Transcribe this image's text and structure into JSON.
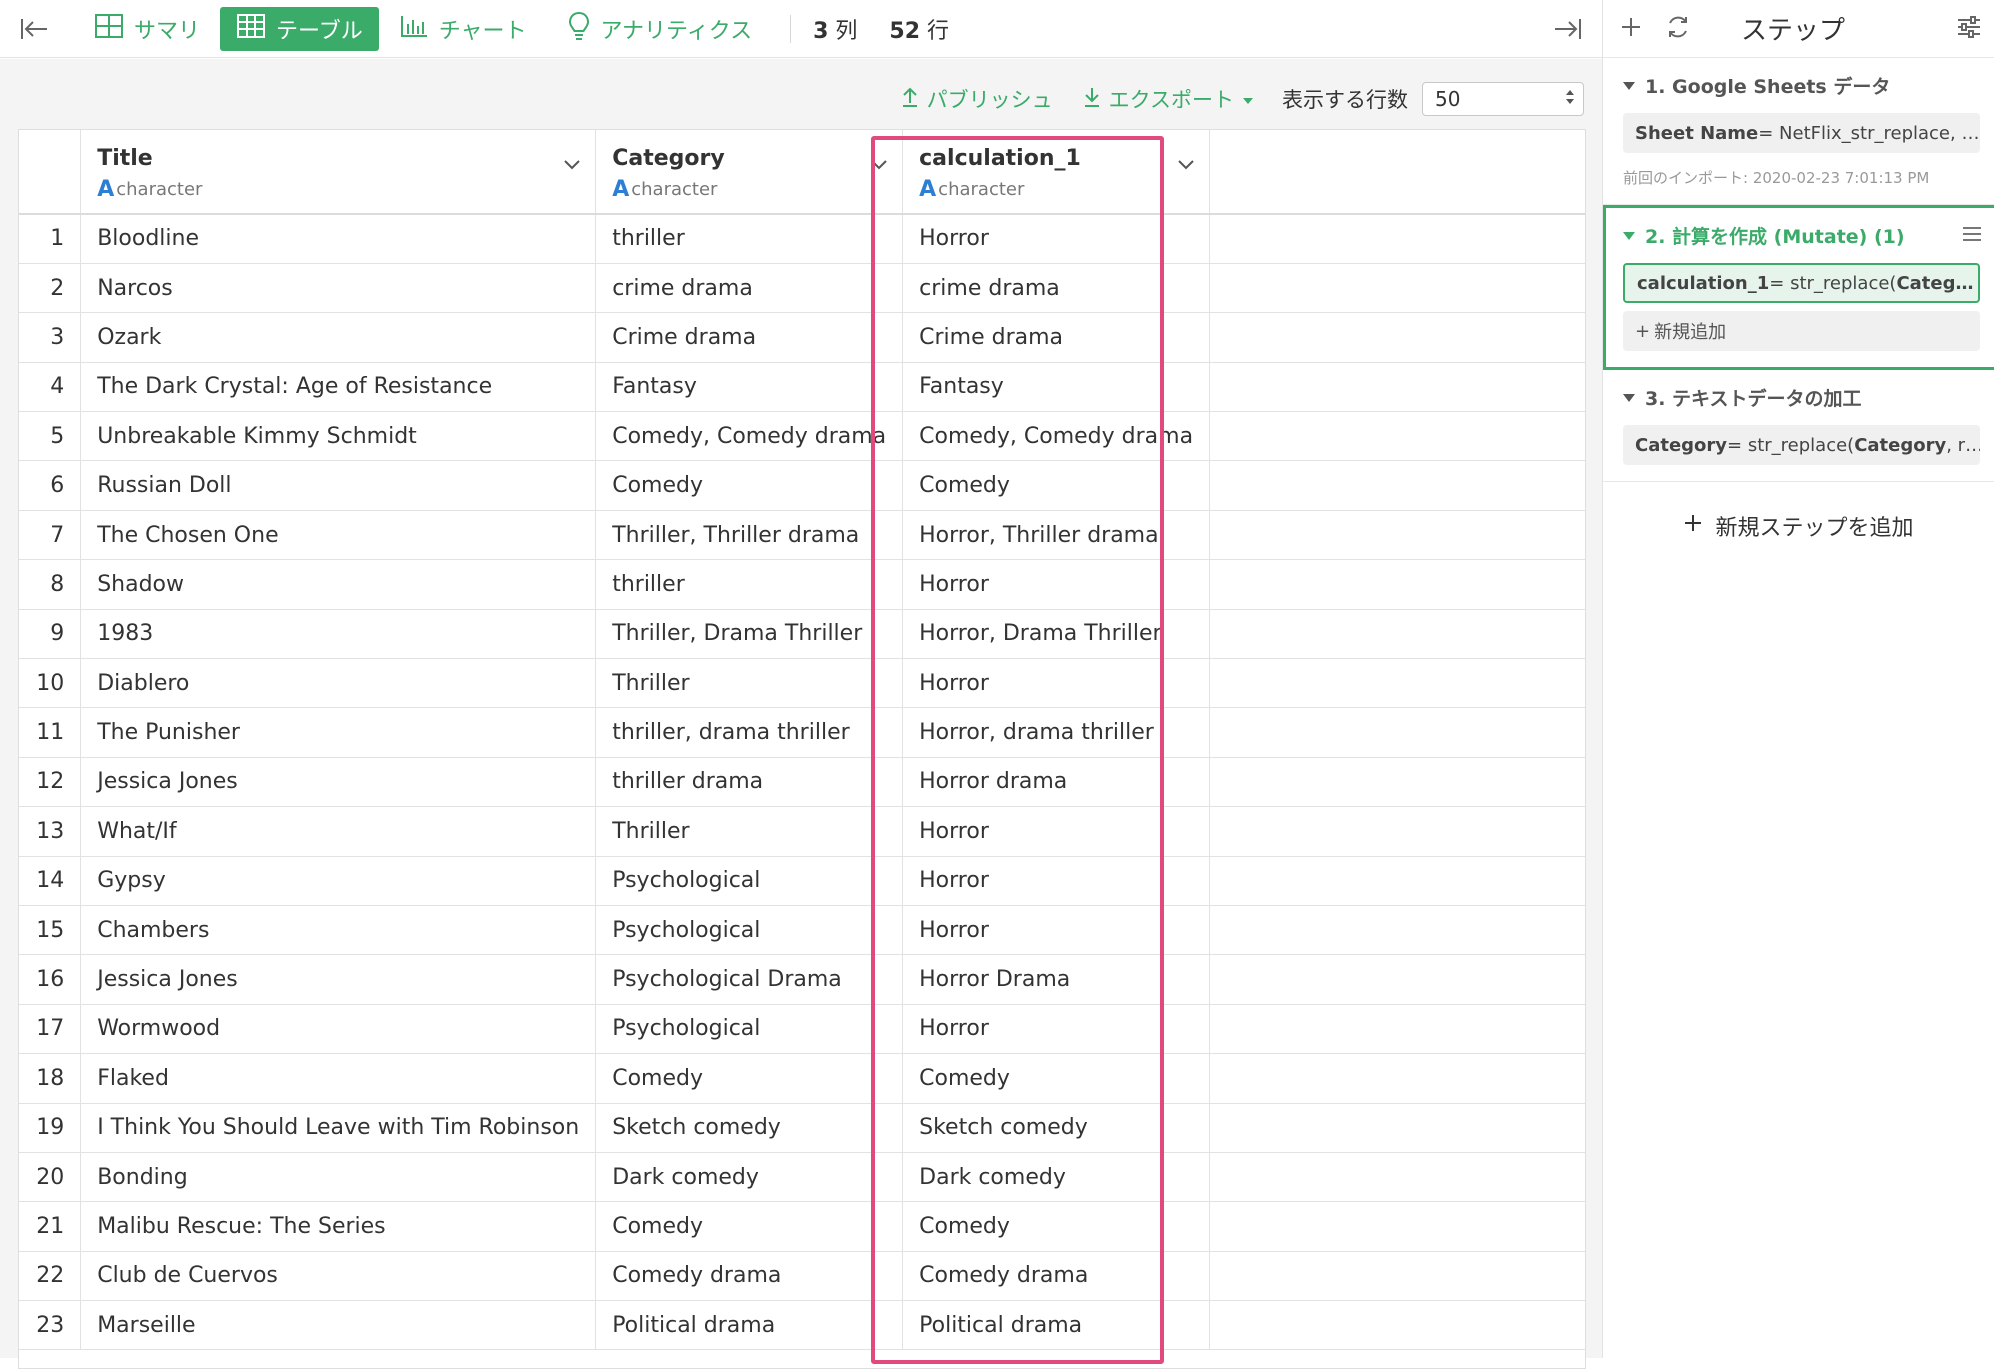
{
  "toolbar": {
    "tabs": [
      {
        "label": "サマリ",
        "icon": "summary-grid-icon"
      },
      {
        "label": "テーブル",
        "icon": "table-icon"
      },
      {
        "label": "チャート",
        "icon": "bar-chart-icon"
      },
      {
        "label": "アナリティクス",
        "icon": "lightbulb-icon"
      }
    ],
    "columns_count": "3",
    "columns_unit": "列",
    "rows_count": "52",
    "rows_unit": "行"
  },
  "subbar": {
    "publish_label": "パブリッシュ",
    "export_label": "エクスポート",
    "rows_label": "表示する行数",
    "rows_value": "50"
  },
  "table": {
    "columns": [
      {
        "name": "Title",
        "type": "character"
      },
      {
        "name": "Category",
        "type": "character"
      },
      {
        "name": "calculation_1",
        "type": "character"
      }
    ],
    "rows": [
      [
        "1",
        "Bloodline",
        "thriller",
        "Horror"
      ],
      [
        "2",
        "Narcos",
        "crime drama",
        "crime drama"
      ],
      [
        "3",
        "Ozark",
        "Crime drama",
        "Crime drama"
      ],
      [
        "4",
        "The Dark Crystal: Age of Resistance",
        "Fantasy",
        "Fantasy"
      ],
      [
        "5",
        "Unbreakable Kimmy Schmidt",
        "Comedy, Comedy drama",
        "Comedy, Comedy drama"
      ],
      [
        "6",
        "Russian Doll",
        "Comedy",
        "Comedy"
      ],
      [
        "7",
        "The Chosen One",
        "Thriller, Thriller drama",
        "Horror, Thriller drama"
      ],
      [
        "8",
        "Shadow",
        "thriller",
        "Horror"
      ],
      [
        "9",
        "1983",
        "Thriller, Drama Thriller",
        "Horror, Drama Thriller"
      ],
      [
        "10",
        "Diablero",
        "Thriller",
        "Horror"
      ],
      [
        "11",
        "The Punisher",
        "thriller,  drama thriller",
        "Horror,  drama thriller"
      ],
      [
        "12",
        "Jessica Jones",
        "thriller drama",
        "Horror drama"
      ],
      [
        "13",
        "What/If",
        "Thriller",
        "Horror"
      ],
      [
        "14",
        "Gypsy",
        "Psychological",
        "Horror"
      ],
      [
        "15",
        "Chambers",
        "Psychological",
        "Horror"
      ],
      [
        "16",
        "Jessica Jones",
        "Psychological Drama",
        "Horror Drama"
      ],
      [
        "17",
        "Wormwood",
        "Psychological",
        "Horror"
      ],
      [
        "18",
        "Flaked",
        "Comedy",
        "Comedy"
      ],
      [
        "19",
        "I Think You Should Leave with Tim Robinson",
        "Sketch comedy",
        "Sketch comedy"
      ],
      [
        "20",
        "Bonding",
        "Dark comedy",
        "Dark comedy"
      ],
      [
        "21",
        "Malibu Rescue: The Series",
        "Comedy",
        "Comedy"
      ],
      [
        "22",
        "Club de Cuervos",
        "Comedy drama",
        "Comedy drama"
      ],
      [
        "23",
        "Marseille",
        "Political drama",
        "Political drama"
      ]
    ]
  },
  "panel": {
    "title": "ステップ",
    "steps": [
      {
        "title": "1. Google Sheets データ",
        "chip_key": "Sheet Name",
        "chip_rest": " = NetFlix_str_replace, …",
        "meta": "前回のインポート: 2020-02-23 7:01:13 PM"
      },
      {
        "title": "2. 計算を作成 (Mutate) (1)",
        "chip_key": "calculation_1",
        "chip_rest": " = str_replace(",
        "chip_key2": "Categ…",
        "add_label": "新規追加"
      },
      {
        "title": "3. テキストデータの加工",
        "chip_key": "Category",
        "chip_rest": " = str_replace(",
        "chip_key2": "Category",
        "chip_rest2": ", r…"
      }
    ],
    "add_step_label": "新規ステップを追加"
  },
  "colors": {
    "accent": "#3bab6a",
    "highlight": "#e04a7c",
    "type_icon": "#2d7fd3"
  }
}
